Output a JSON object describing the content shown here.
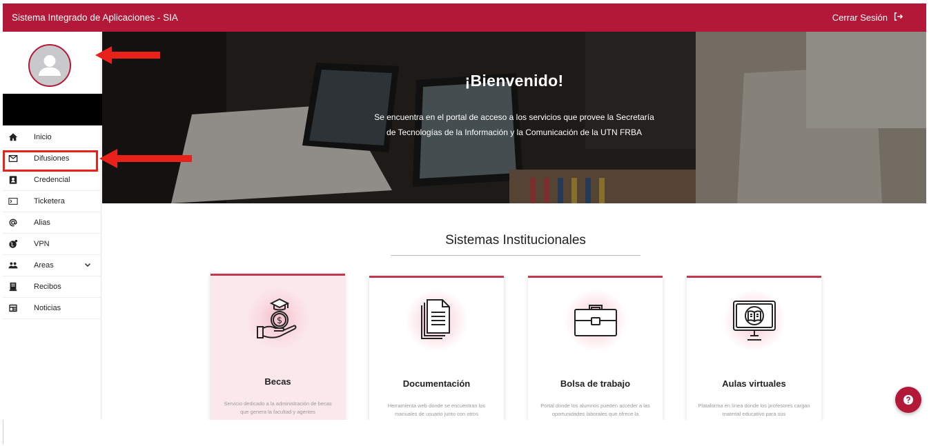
{
  "header": {
    "app_title": "Sistema Integrado de Aplicaciones - SIA",
    "logout_label": "Cerrar Sesión",
    "logout_icon": "logout-icon",
    "bg_color": "#b31839"
  },
  "sidebar": {
    "avatar_icon": "user-avatar-icon",
    "items": [
      {
        "label": "Inicio",
        "icon": "home-icon"
      },
      {
        "label": "Difusiones",
        "icon": "mail-icon"
      },
      {
        "label": "Credencial",
        "icon": "id-card-icon"
      },
      {
        "label": "Ticketera",
        "icon": "ticket-icon"
      },
      {
        "label": "Alias",
        "icon": "at-icon"
      },
      {
        "label": "VPN",
        "icon": "globe-icon"
      },
      {
        "label": "Areas",
        "icon": "people-icon",
        "has_submenu": true
      },
      {
        "label": "Recibos",
        "icon": "receipt-icon"
      },
      {
        "label": "Noticias",
        "icon": "news-icon"
      }
    ]
  },
  "hero": {
    "title": "¡Bienvenido!",
    "text": "Se encuentra en el portal de acceso a los servicios que provee la Secretaría de Tecnologías de la Información y la Comunicación de la UTN FRBA"
  },
  "section": {
    "title": "Sistemas Institucionales"
  },
  "cards": [
    {
      "title": "Becas",
      "icon": "scholarship-icon",
      "description": "Servicio dedicado a la administración de becas que genera la facultad y agentes"
    },
    {
      "title": "Documentación",
      "icon": "documents-icon",
      "description": "Herramienta web donde se encuentran los manuales de usuario junto con otros"
    },
    {
      "title": "Bolsa de trabajo",
      "icon": "briefcase-icon",
      "description": "Portal donde los alumnos pueden acceder a las oportunidades laborales que ofrece la"
    },
    {
      "title": "Aulas virtuales",
      "icon": "virtual-classroom-icon",
      "description": "Plataforma en línea donde los profesores cargan material educativo para sus"
    }
  ],
  "help_button_icon": "help-icon",
  "annotation_color": "#e8211a"
}
